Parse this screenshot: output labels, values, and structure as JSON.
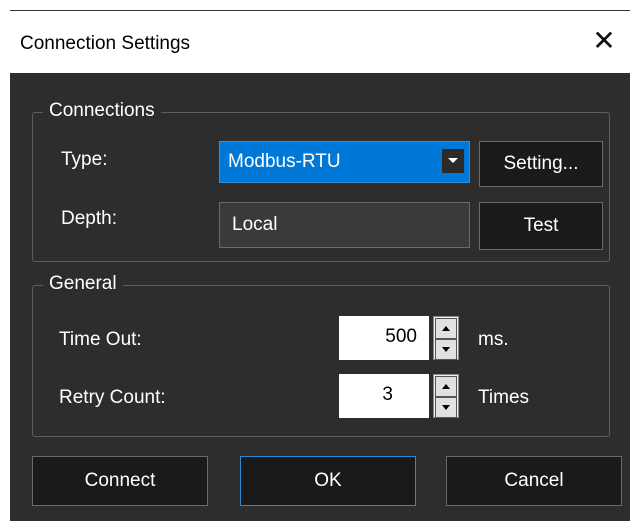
{
  "window": {
    "title": "Connection Settings",
    "close_icon": "close-icon"
  },
  "connections": {
    "legend": "Connections",
    "type_label": "Type:",
    "type_value": "Modbus-RTU",
    "setting_button": "Setting...",
    "depth_label": "Depth:",
    "depth_value": "Local",
    "test_button": "Test"
  },
  "general": {
    "legend": "General",
    "timeout_label": "Time Out:",
    "timeout_value": "500",
    "timeout_unit": "ms.",
    "retry_label": "Retry Count:",
    "retry_value": "3",
    "retry_unit": "Times"
  },
  "buttons": {
    "connect": "Connect",
    "ok": "OK",
    "cancel": "Cancel"
  },
  "colors": {
    "dialog_bg": "#2d2d2d",
    "combo_accent": "#0078d7",
    "default_button_border": "#2a8ad4"
  }
}
